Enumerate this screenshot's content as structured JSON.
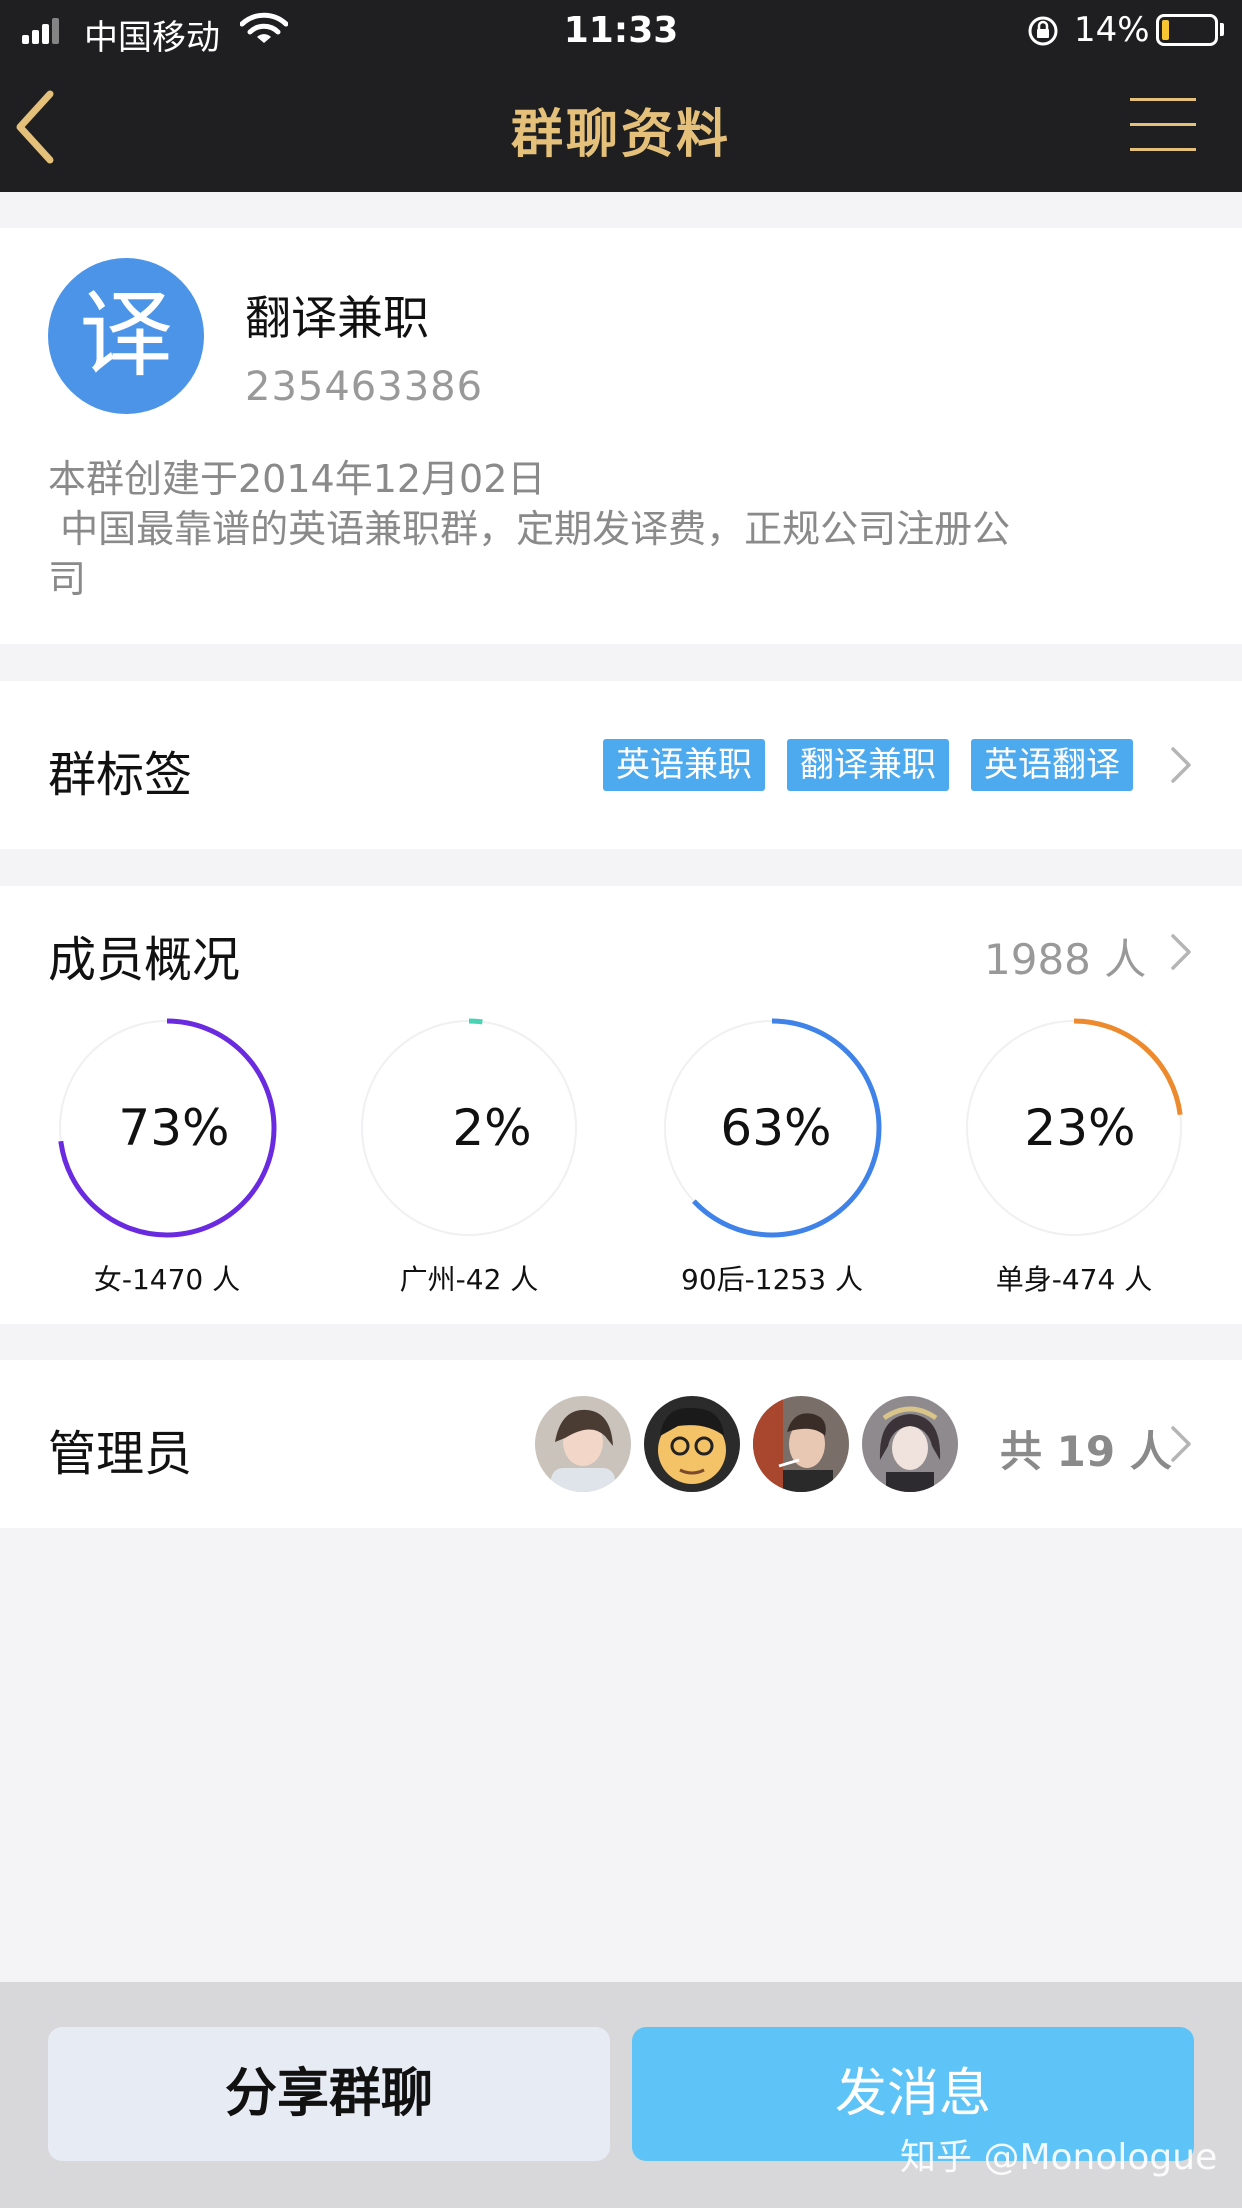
{
  "status_bar": {
    "carrier": "中国移动",
    "time": "11:33",
    "battery": "14%",
    "battery_fraction": 0.14
  },
  "nav": {
    "title": "群聊资料",
    "accent_color": "#e4c07a"
  },
  "group": {
    "avatar_char": "译",
    "avatar_color": "#4c94e8",
    "name": "翻译兼职",
    "id": "235463386",
    "created": "本群创建于2014年12月02日",
    "description": " 中国最靠谱的英语兼职群，定期发译费，正规公司注册公\n司"
  },
  "tags_row": {
    "title": "群标签",
    "tags": [
      "英语兼职",
      "翻译兼职",
      "英语翻译"
    ],
    "tag_color": "#4daaee"
  },
  "members": {
    "title": "成员概况",
    "count": "1988 人",
    "stats": [
      {
        "value": "73%",
        "fraction": 0.73,
        "label": "女-1470 人",
        "color": "#6a2be0"
      },
      {
        "value": "2%",
        "fraction": 0.02,
        "label": "广州-42 人",
        "color": "#47d4b4"
      },
      {
        "value": "63%",
        "fraction": 0.63,
        "label": "90后-1253 人",
        "color": "#4083e8"
      },
      {
        "value": "23%",
        "fraction": 0.23,
        "label": "单身-474 人",
        "color": "#ee8a2e"
      }
    ]
  },
  "admins": {
    "title": "管理员",
    "total": "共 19 人"
  },
  "actions": {
    "share": "分享群聊",
    "send": "发消息"
  },
  "watermark": "知乎 @Monologue"
}
